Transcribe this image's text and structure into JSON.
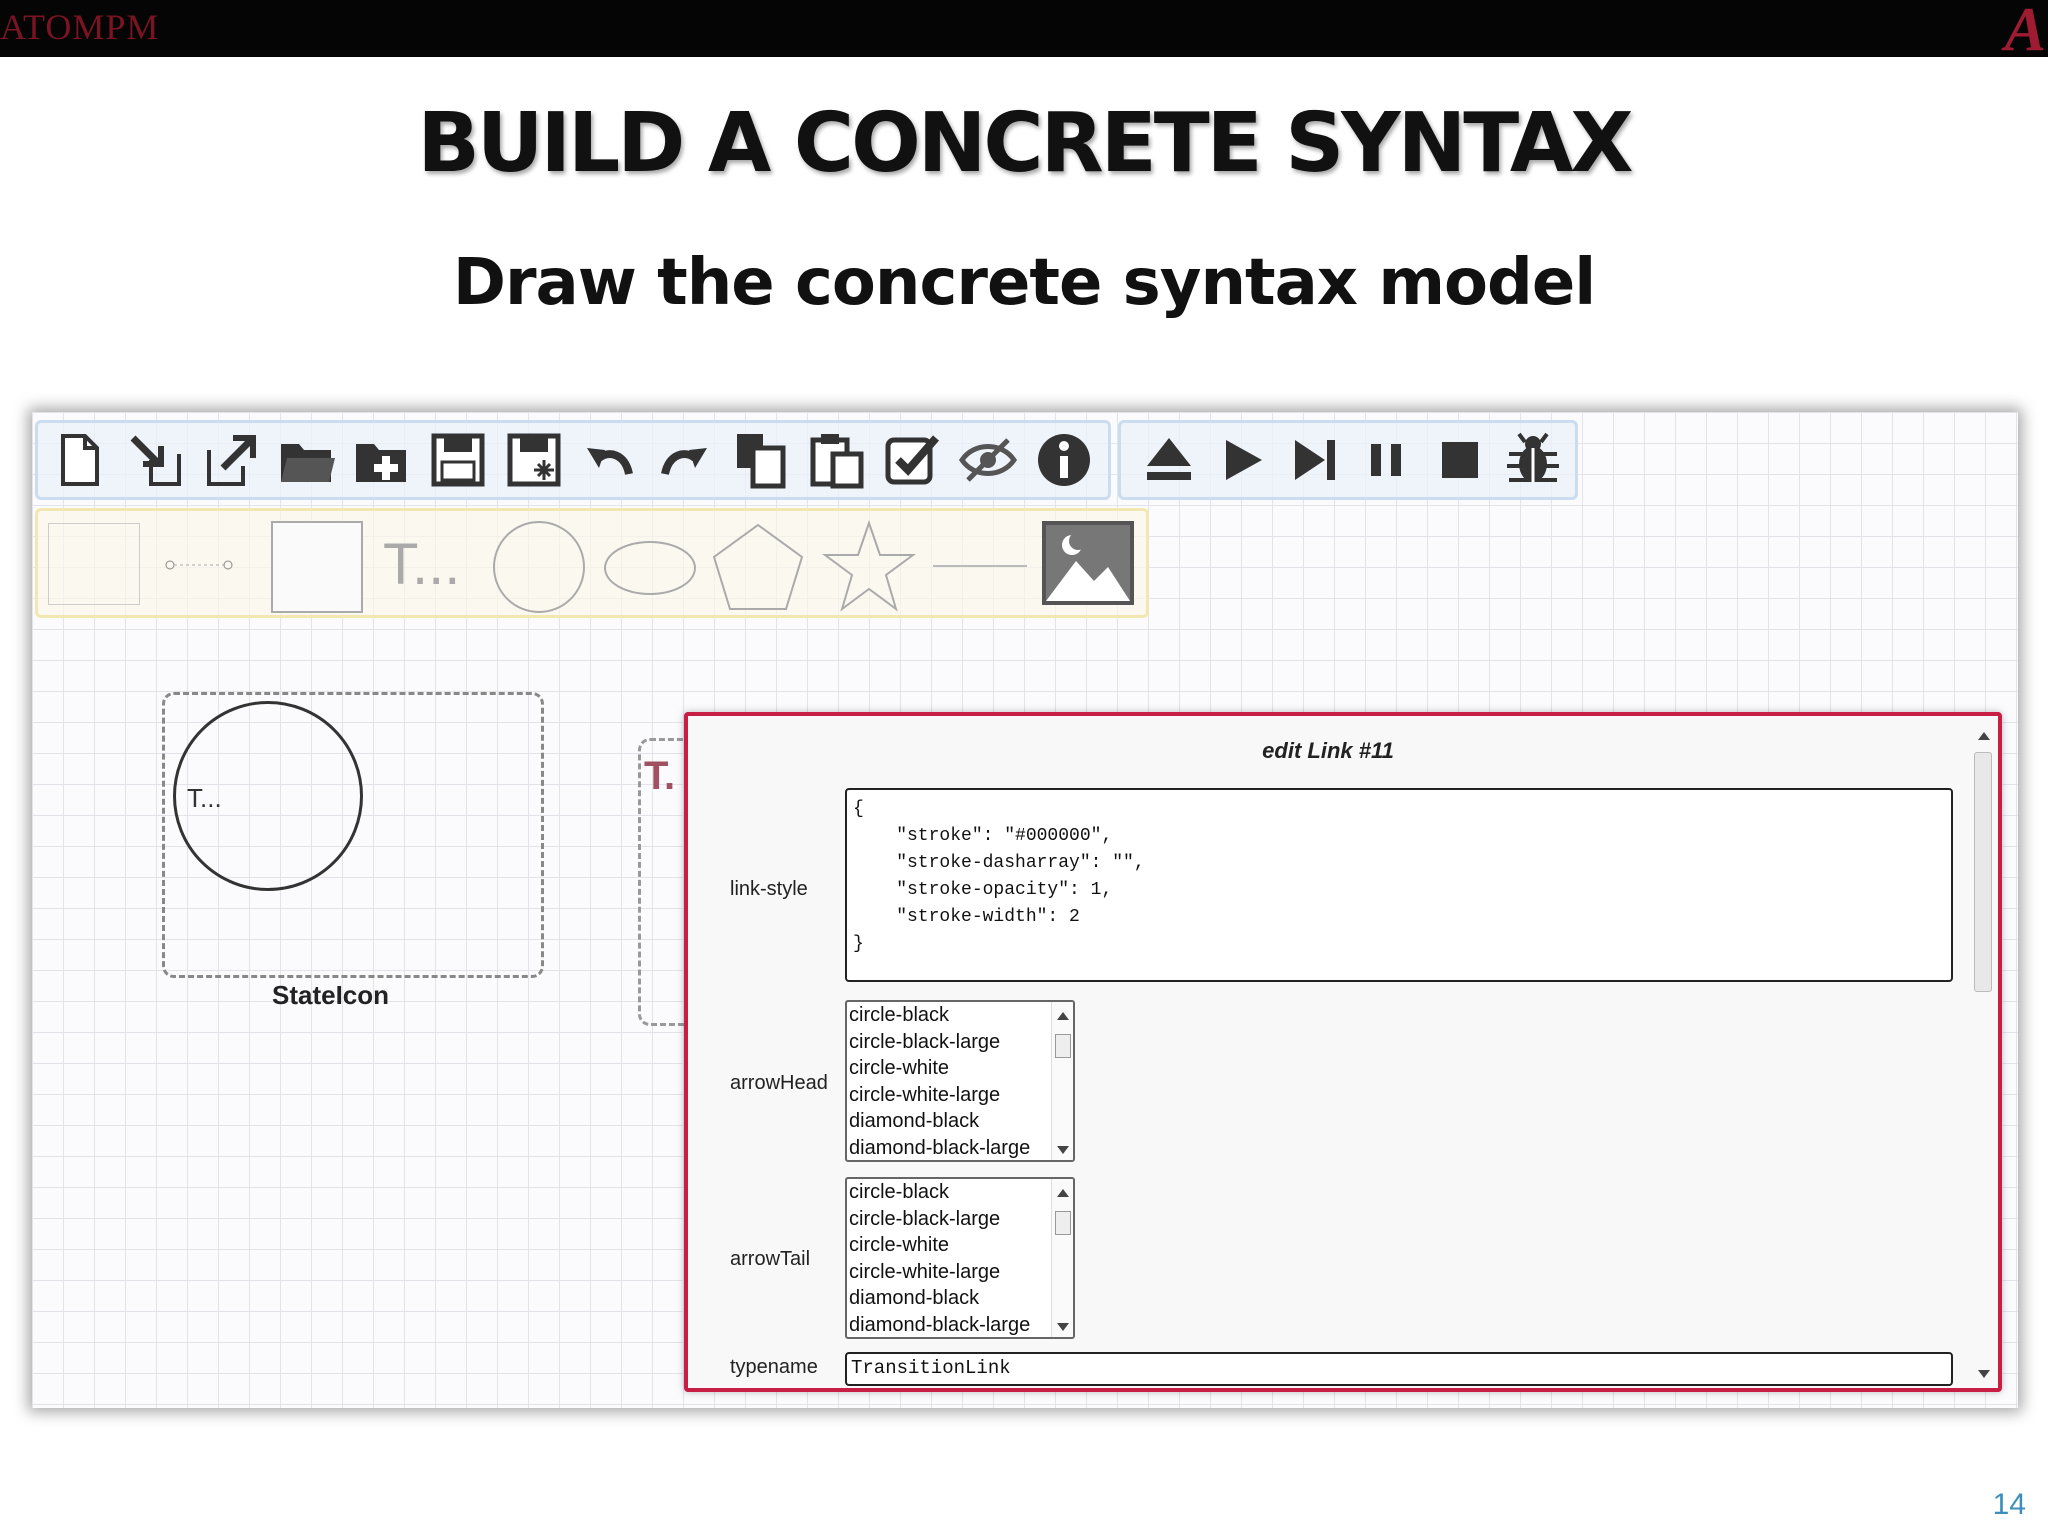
{
  "header": {
    "app_logo": "ATOMPM",
    "institution_logo": "A"
  },
  "slide": {
    "title": "BUILD A CONCRETE SYNTAX",
    "subtitle": "Draw the concrete syntax model",
    "page_number": "14"
  },
  "toolbar": {
    "file_tools": [
      "new-icon",
      "import-icon",
      "export-icon",
      "open-folder-icon",
      "new-folder-icon",
      "save-icon",
      "save-as-icon",
      "undo-icon",
      "redo-icon",
      "copy-icon",
      "paste-icon",
      "validate-icon",
      "hide-icon",
      "info-icon"
    ],
    "run_tools": [
      "eject-icon",
      "play-icon",
      "step-icon",
      "pause-icon",
      "stop-icon",
      "debug-bug-icon"
    ]
  },
  "shapes": {
    "items": [
      "rectangle-shape",
      "link-shape",
      "square-shape",
      "text-shape",
      "circle-shape",
      "ellipse-shape",
      "pentagon-shape",
      "star-shape",
      "line-shape",
      "image-shape"
    ],
    "text_shape_label": "T..."
  },
  "canvas": {
    "stateicon_text": "T...",
    "stateicon_label": "StateIcon",
    "partial_text": "T."
  },
  "dialog": {
    "title": "edit Link #11",
    "link_style_label": "link-style",
    "link_style_value": "{\n    \"stroke\": \"#000000\",\n    \"stroke-dasharray\": \"\",\n    \"stroke-opacity\": 1,\n    \"stroke-width\": 2\n}",
    "arrow_head_label": "arrowHead",
    "arrow_head_options": [
      "circle-black",
      "circle-black-large",
      "circle-white",
      "circle-white-large",
      "diamond-black",
      "diamond-black-large"
    ],
    "arrow_tail_label": "arrowTail",
    "arrow_tail_options": [
      "circle-black",
      "circle-black-large",
      "circle-white",
      "circle-white-large",
      "diamond-black",
      "diamond-black-large"
    ],
    "typename_label": "typename",
    "typename_value": "TransitionLink"
  },
  "colors": {
    "dialog_border": "#c81e45",
    "page_number": "#3d8dbd",
    "logo_red": "#9e1b32"
  }
}
